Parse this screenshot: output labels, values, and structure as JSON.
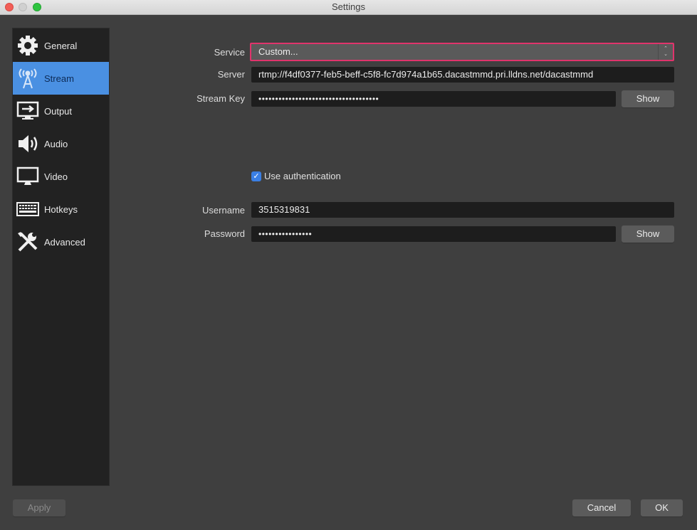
{
  "window": {
    "title": "Settings"
  },
  "sidebar": {
    "items": [
      {
        "label": "General",
        "icon": "gear-icon",
        "selected": false
      },
      {
        "label": "Stream",
        "icon": "broadcast-tower-icon",
        "selected": true
      },
      {
        "label": "Output",
        "icon": "output-monitor-icon",
        "selected": false
      },
      {
        "label": "Audio",
        "icon": "speaker-icon",
        "selected": false
      },
      {
        "label": "Video",
        "icon": "monitor-icon",
        "selected": false
      },
      {
        "label": "Hotkeys",
        "icon": "keyboard-icon",
        "selected": false
      },
      {
        "label": "Advanced",
        "icon": "tools-icon",
        "selected": false
      }
    ]
  },
  "stream": {
    "service_label": "Service",
    "service_value": "Custom...",
    "server_label": "Server",
    "server_value": "rtmp://f4df0377-feb5-beff-c5f8-fc7d974a1b65.dacastmmd.pri.lldns.net/dacastmmd",
    "stream_key_label": "Stream Key",
    "stream_key_masked": "••••••••••••••••••••••••••••••••••••",
    "stream_key_show": "Show",
    "use_auth_label": "Use authentication",
    "use_auth_checked": true,
    "username_label": "Username",
    "username_value": "3515319831",
    "password_label": "Password",
    "password_masked": "••••••••••••••••",
    "password_show": "Show"
  },
  "footer": {
    "apply": "Apply",
    "cancel": "Cancel",
    "ok": "OK"
  },
  "colors": {
    "accent_selected": "#4a90e2",
    "highlight_border": "#e0346c",
    "checkbox": "#3a7fe4"
  }
}
